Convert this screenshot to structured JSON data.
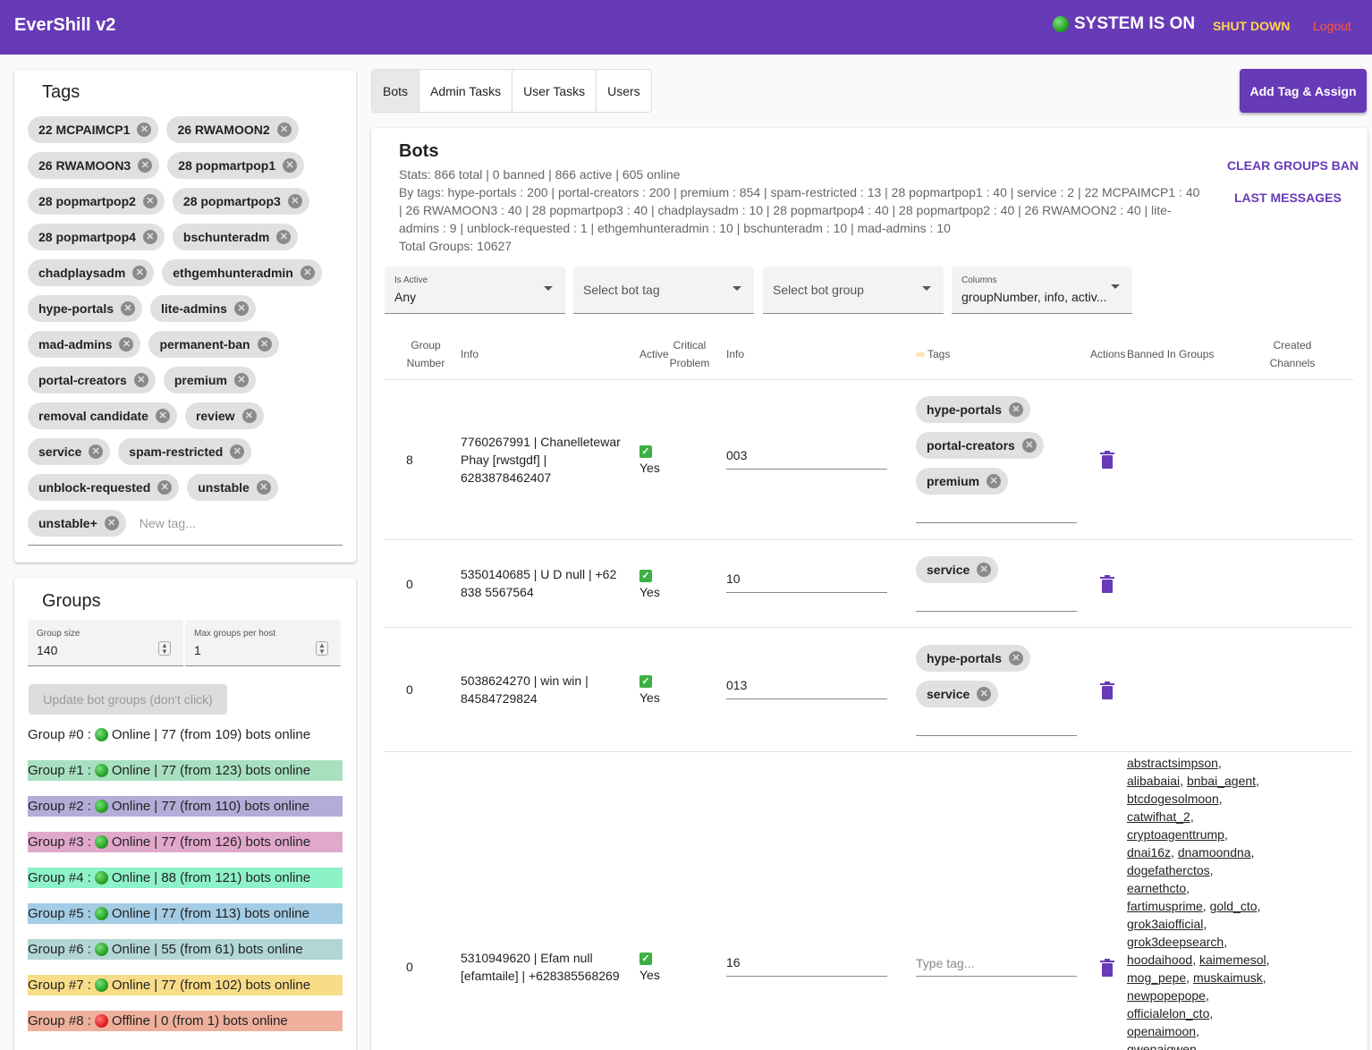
{
  "header": {
    "app_title": "EverShill v2",
    "system_status": "SYSTEM IS ON",
    "shutdown_label": "SHUT DOWN",
    "logout_label": "Logout"
  },
  "tags_panel": {
    "title": "Tags",
    "tags": [
      "22 MCPAIMCP1",
      "26 RWAMOON2",
      "26 RWAMOON3",
      "28 popmartpop1",
      "28 popmartpop2",
      "28 popmartpop3",
      "28 popmartpop4",
      "bschunteradm",
      "chadplaysadm",
      "ethgemhunteradmin",
      "hype-portals",
      "lite-admins",
      "mad-admins",
      "permanent-ban",
      "portal-creators",
      "premium",
      "removal candidate",
      "review",
      "service",
      "spam-restricted",
      "unblock-requested",
      "unstable",
      "unstable+"
    ],
    "new_tag_placeholder": "New tag..."
  },
  "groups_panel": {
    "title": "Groups",
    "group_size_label": "Group size",
    "group_size_value": "140",
    "max_groups_label": "Max groups per host",
    "max_groups_value": "1",
    "update_button": "Update bot groups (don't click)",
    "groups": [
      {
        "label": "Group #0 :",
        "status": "Online",
        "text": "| 77 (from 109) bots online",
        "color": "#ffffff",
        "online": true
      },
      {
        "label": "Group #1 :",
        "status": "Online",
        "text": "| 77 (from 123) bots online",
        "color": "#a8e0c0",
        "online": true
      },
      {
        "label": "Group #2 :",
        "status": "Online",
        "text": "| 77 (from 110) bots online",
        "color": "#b4acd8",
        "online": true
      },
      {
        "label": "Group #3 :",
        "status": "Online",
        "text": "| 77 (from 126) bots online",
        "color": "#e2a8cc",
        "online": true
      },
      {
        "label": "Group #4 :",
        "status": "Online",
        "text": "| 88 (from 121) bots online",
        "color": "#8ef2c8",
        "online": true
      },
      {
        "label": "Group #5 :",
        "status": "Online",
        "text": "| 77 (from 113) bots online",
        "color": "#a4cce4",
        "online": true
      },
      {
        "label": "Group #6 :",
        "status": "Online",
        "text": "| 55 (from 61) bots online",
        "color": "#b2d6d6",
        "online": true
      },
      {
        "label": "Group #7 :",
        "status": "Online",
        "text": "| 77 (from 102) bots online",
        "color": "#f8dc88",
        "online": true
      },
      {
        "label": "Group #8 :",
        "status": "Offline",
        "text": "| 0 (from 1) bots online",
        "color": "#eeb09c",
        "online": false
      }
    ]
  },
  "tabs": [
    "Bots",
    "Admin Tasks",
    "User Tasks",
    "Users"
  ],
  "add_tag_button": "Add Tag & Assign",
  "bots": {
    "title": "Bots",
    "stats_line": "Stats: 866 total | 0 banned | 866 active | 605 online",
    "by_tags_line": "By tags: hype-portals : 200 | portal-creators : 200 | premium : 854 | spam-restricted : 13 | 28 popmartpop1 : 40 | service : 2 | 22 MCPAIMCP1 : 40 | 26 RWAMOON3 : 40 | 28 popmartpop3 : 40 | chadplaysadm : 10 | 28 popmartpop4 : 40 | 28 popmartpop2 : 40 | 26 RWAMOON2 : 40 | lite-admins : 9 | unblock-requested : 1 | ethgemhunteradmin : 10 | bschunteradm : 10 | mad-admins : 10",
    "total_groups_line": "Total Groups: 10627",
    "clear_groups_ban": "CLEAR GROUPS BAN",
    "last_messages": "LAST MESSAGES",
    "filters": {
      "is_active_label": "Is Active",
      "is_active_value": "Any",
      "bot_tag_placeholder": "Select bot tag",
      "bot_group_placeholder": "Select bot group",
      "columns_label": "Columns",
      "columns_value": "groupNumber, info, activ..."
    },
    "columns": {
      "group_number_1": "Group",
      "group_number_2": "Number",
      "info": "Info",
      "active": "Active",
      "critical_1": "Critical",
      "critical_2": "Problem",
      "info2": "Info",
      "tags": "Tags",
      "actions": "Actions",
      "banned": "Banned In Groups",
      "created_1": "Created",
      "created_2": "Channels"
    },
    "rows": [
      {
        "group": "8",
        "info": "7760267991 | Chanelletewar Phay [rwstgdf] | 6283878462407",
        "active": "Yes",
        "note": "003",
        "tags": [
          "hype-portals",
          "portal-creators",
          "premium"
        ]
      },
      {
        "group": "0",
        "info": "5350140685 | U D null | +62 838 5567564",
        "active": "Yes",
        "note": "10",
        "tags": [
          "service"
        ]
      },
      {
        "group": "0",
        "info": "5038624270 | win win | 84584729824",
        "active": "Yes",
        "note": "013",
        "tags": [
          "hype-portals",
          "service"
        ]
      },
      {
        "group": "0",
        "info": "5310949620 | Efam null [efamtaile] | +628385568269",
        "active": "Yes",
        "note": "16",
        "tags": [],
        "tag_placeholder": "Type tag..."
      }
    ],
    "banned_groups_row4": [
      [
        "abstractsimpson"
      ],
      [
        "alibabaiai",
        "bnbai_agent"
      ],
      [
        "btcdogesolmoon"
      ],
      [
        "catwifhat_2"
      ],
      [
        "cryptoagenttrump"
      ],
      [
        "dnai16z",
        "dnamoondna"
      ],
      [
        "dogefatherctos"
      ],
      [
        "earnethcto"
      ],
      [
        "fartimusprime",
        "gold_cto"
      ],
      [
        "grok3aiofficial"
      ],
      [
        "grok3deepsearch"
      ],
      [
        "hoodaihood",
        "kaimemesol"
      ],
      [
        "mog_pepe",
        "muskaimusk"
      ],
      [
        "newpopepope"
      ],
      [
        "officialelon_cto"
      ],
      [
        "openaimoon"
      ],
      [
        "qwenaiqwen"
      ]
    ]
  }
}
